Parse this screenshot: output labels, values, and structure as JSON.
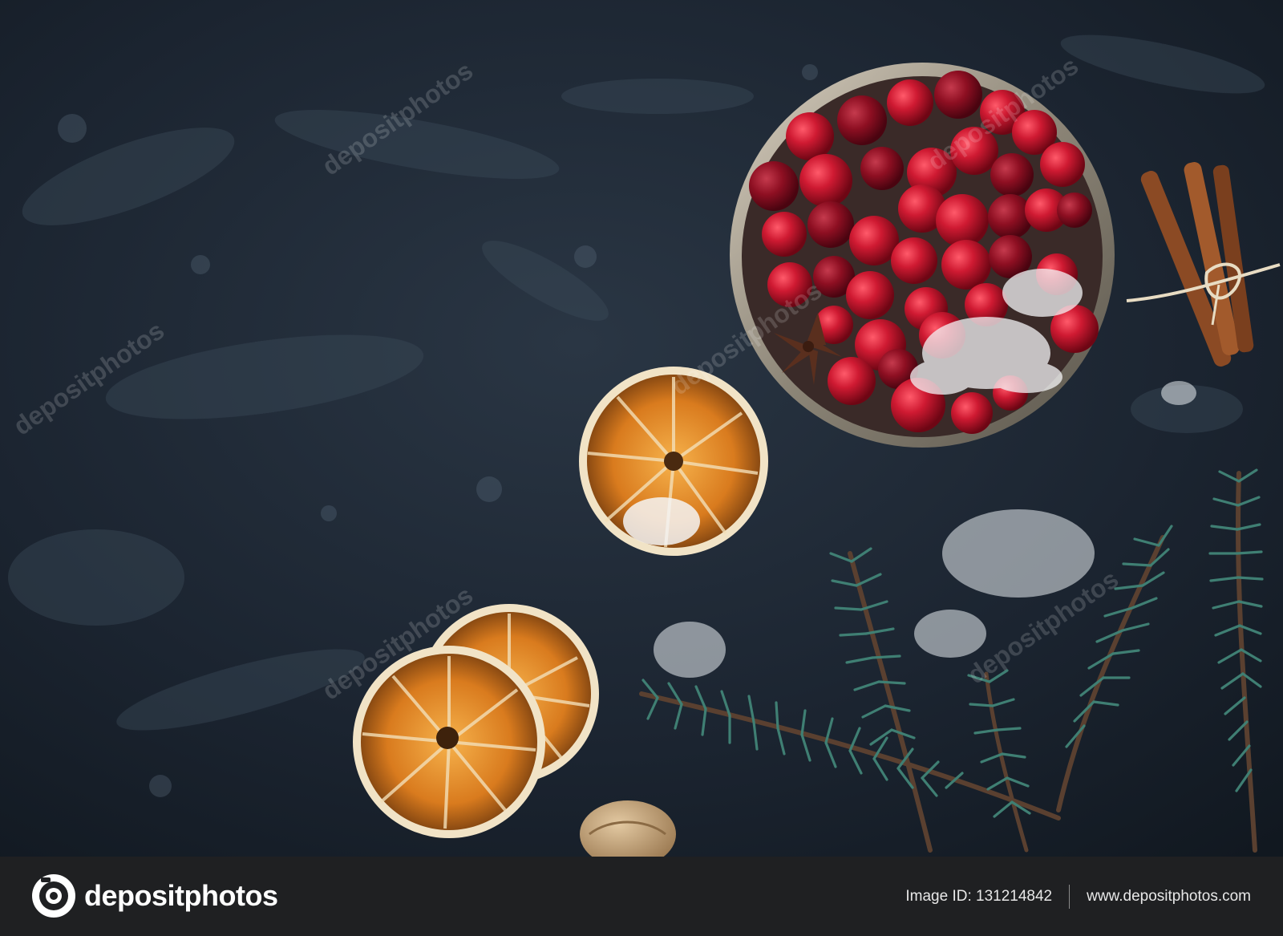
{
  "image": {
    "description_icon": "photograph",
    "colors": {
      "background": "#1d2733",
      "footer": "#1f2022",
      "cranberry": "#c0152a",
      "orange": "#e08a2a",
      "fir": "#2f6b5a"
    }
  },
  "watermark": {
    "text": "depositphotos"
  },
  "footer": {
    "brand_text": "depositphotos",
    "image_id": "Image ID: 131214842",
    "website": "www.depositphotos.com"
  }
}
